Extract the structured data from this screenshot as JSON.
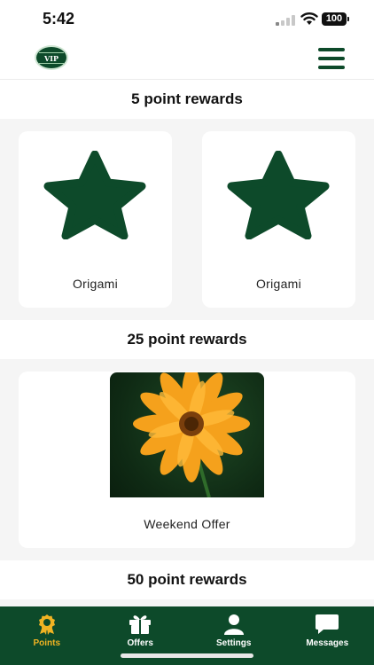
{
  "status_bar": {
    "time": "5:42",
    "battery": "100"
  },
  "header": {
    "logo_text": "VIP"
  },
  "sections": [
    {
      "title": "5 point rewards",
      "items": [
        {
          "label": "Origami",
          "icon": "star-icon"
        },
        {
          "label": "Origami",
          "icon": "star-icon"
        }
      ]
    },
    {
      "title": "25 point rewards",
      "items": [
        {
          "label": "Weekend Offer",
          "image": "orange-flower-photo"
        }
      ]
    },
    {
      "title": "50 point rewards",
      "items": []
    }
  ],
  "tabs": [
    {
      "label": "Points",
      "icon": "award-icon",
      "active": true
    },
    {
      "label": "Offers",
      "icon": "gift-icon",
      "active": false
    },
    {
      "label": "Settings",
      "icon": "user-icon",
      "active": false
    },
    {
      "label": "Messages",
      "icon": "chat-icon",
      "active": false
    }
  ],
  "colors": {
    "brand": "#0d4a2a",
    "active_tab": "#f0b323",
    "background": "#f5f5f5"
  }
}
